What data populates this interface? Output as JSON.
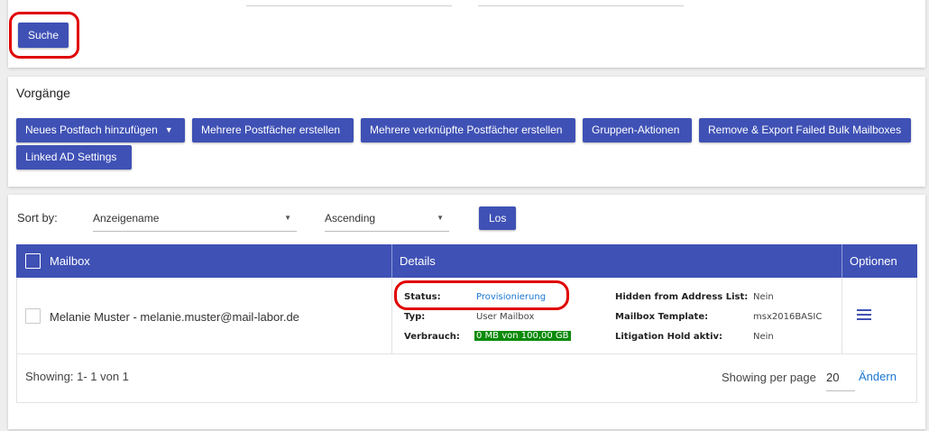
{
  "search": {
    "button_label": "Suche"
  },
  "actions": {
    "title": "Vorgänge",
    "buttons": [
      "Neues Postfach hinzufügen",
      "Mehrere Postfächer erstellen",
      "Mehrere verknüpfte Postfächer erstellen",
      "Gruppen-Aktionen",
      "Remove & Export Failed Bulk Mailboxes",
      "Linked AD Settings"
    ]
  },
  "sort": {
    "label": "Sort by:",
    "field_value": "Anzeigename",
    "order_value": "Ascending",
    "go_label": "Los"
  },
  "table": {
    "headers": {
      "mailbox": "Mailbox",
      "details": "Details",
      "options": "Optionen"
    },
    "rows": [
      {
        "mailbox": "Melanie Muster - melanie.muster@mail-labor.de",
        "details": {
          "status_key": "Status:",
          "status_value": "Provisionierung",
          "type_key": "Typ:",
          "type_value": "User Mailbox",
          "usage_key": "Verbrauch:",
          "usage_value": "0 MB von 100,00 GB",
          "hidden_key": "Hidden from Address List:",
          "hidden_value": "Nein",
          "template_key": "Mailbox Template:",
          "template_value": "msx2016BASIC",
          "hold_key": "Litigation Hold aktiv:",
          "hold_value": "Nein"
        }
      }
    ]
  },
  "footer": {
    "showing": "Showing: 1- 1 von 1",
    "per_page_label": "Showing per page",
    "per_page_value": "20",
    "change_link": "Ändern"
  },
  "colors": {
    "primary": "#3f51b5",
    "highlight_red": "#e00000",
    "usage_green": "#0a8a0a",
    "link": "#1976d2"
  },
  "icons": {
    "row_menu": "hamburger-menu-icon",
    "dropdown": "caret-down-icon"
  }
}
